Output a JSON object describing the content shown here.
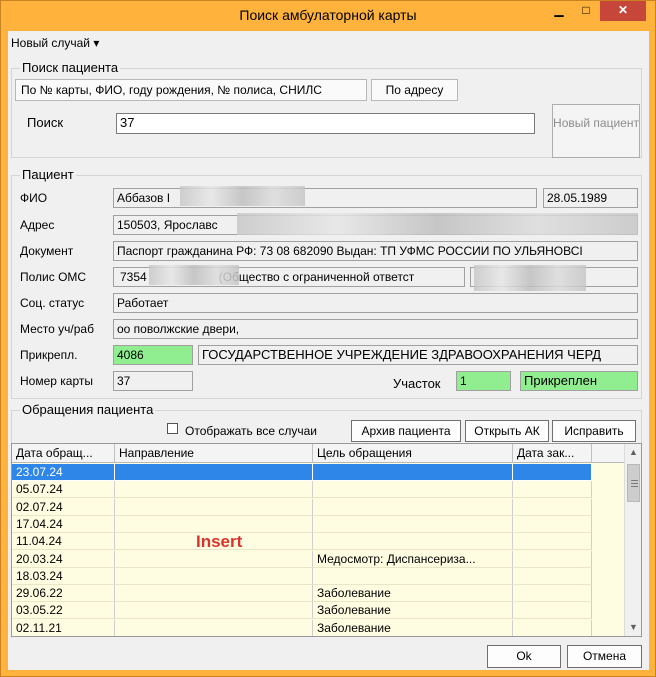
{
  "window": {
    "title": "Поиск амбулаторной карты",
    "minimize": "▁",
    "maximize": "□",
    "close": "✕"
  },
  "menu": {
    "new_case": "Новый случай ▾"
  },
  "search": {
    "group_label": "Поиск пациента",
    "tabs": [
      "По № карты, ФИО, году рождения, № полиса, СНИЛС",
      "По адресу"
    ],
    "label": "Поиск",
    "value": "37",
    "new_patient_button": "Новый пациент"
  },
  "patient": {
    "group_label": "Пациент",
    "labels": {
      "fio": "ФИО",
      "address": "Адрес",
      "document": "Документ",
      "policy": "Полис ОМС",
      "social": "Соц. статус",
      "work": "Место уч/раб",
      "attached": "Прикрепл.",
      "card_number": "Номер карты",
      "district": "Участок"
    },
    "fio": "Аббазов I",
    "birth_date": "28.05.1989",
    "address": "150503, Ярославс",
    "document": "Паспорт гражданина РФ: 73 08 682090 Выдан: ТП УФМС РОССИИ ПО УЛЬЯНОВСІ",
    "policy_prefix": "7354",
    "policy_company": "(Общество с ограниченной ответст",
    "social_status": "Работает",
    "workplace": "оо поволжские двери,",
    "attach_code": "4086",
    "attach_org": "ГОСУДАРСТВЕННОЕ УЧРЕЖДЕНИЕ ЗДРАВООХРАНЕНИЯ ЧЕРД",
    "card_number": "37",
    "district": "1",
    "attach_status": "Прикреплен"
  },
  "visits": {
    "group_label": "Обращения пациента",
    "show_all_label": "Отображать все случаи",
    "buttons": {
      "archive": "Архив пациента",
      "open": "Открыть АК",
      "fix": "Исправить"
    },
    "columns": [
      "Дата обращ...",
      "Направление",
      "Цель обращения",
      "Дата зак..."
    ],
    "rows": [
      {
        "date": "23.07.24",
        "direction": "",
        "purpose": "",
        "closed": ""
      },
      {
        "date": "05.07.24",
        "direction": "",
        "purpose": "",
        "closed": ""
      },
      {
        "date": "02.07.24",
        "direction": "",
        "purpose": "",
        "closed": ""
      },
      {
        "date": "17.04.24",
        "direction": "",
        "purpose": "",
        "closed": ""
      },
      {
        "date": "11.04.24",
        "direction": "",
        "purpose": "",
        "closed": ""
      },
      {
        "date": "20.03.24",
        "direction": "",
        "purpose": "Медосмотр: Диспансериза...",
        "closed": ""
      },
      {
        "date": "18.03.24",
        "direction": "",
        "purpose": "",
        "closed": ""
      },
      {
        "date": "29.06.22",
        "direction": "",
        "purpose": "Заболевание",
        "closed": ""
      },
      {
        "date": "03.05.22",
        "direction": "",
        "purpose": "Заболевание",
        "closed": ""
      },
      {
        "date": "02.11.21",
        "direction": "",
        "purpose": "Заболевание",
        "closed": ""
      }
    ],
    "selected_row": 0,
    "overlay_text": "Insert"
  },
  "footer": {
    "ok": "Ok",
    "cancel": "Отмена"
  }
}
